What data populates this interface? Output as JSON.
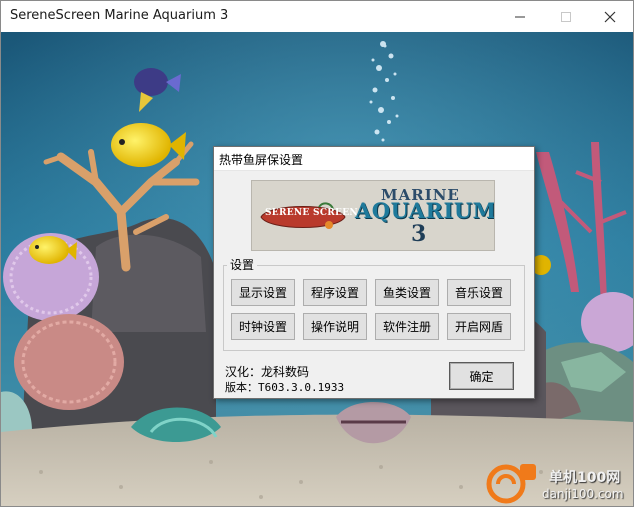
{
  "window": {
    "title": "SereneScreen Marine Aquarium 3"
  },
  "dialog": {
    "title": "热带鱼屏保设置",
    "banner": {
      "logo_text": "SERENE SCREEN",
      "line1": "MARINE",
      "line2": "AQUARIUM",
      "line3": "3"
    },
    "group_label": "设置",
    "buttons": [
      "显示设置",
      "程序设置",
      "鱼类设置",
      "音乐设置",
      "时钟设置",
      "操作说明",
      "软件注册",
      "开启网盾"
    ],
    "localization": "汉化：龙科数码",
    "version": "版本：T603.3.0.1933",
    "ok_label": "确定"
  },
  "watermark": {
    "line1": "单机100网",
    "line2": "danji100.com"
  },
  "colors": {
    "water_top": "#1c5a7c",
    "water_mid": "#2f7fa0",
    "sand": "#c8c0b0",
    "dialog_bg": "#f0f0f0",
    "button_bg": "#e1e1e1",
    "watermark_orange": "#f07a1a"
  },
  "icons": {
    "minimize": "minimize-icon",
    "maximize": "maximize-icon",
    "close": "close-icon"
  }
}
